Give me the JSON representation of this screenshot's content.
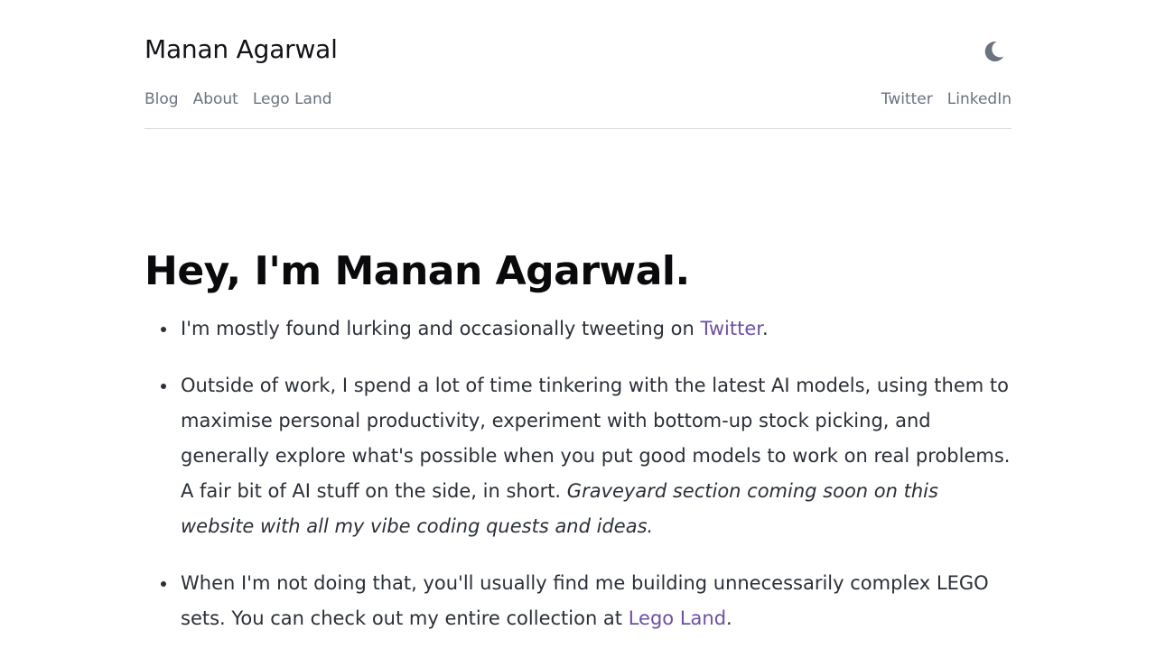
{
  "header": {
    "site_title": "Manan Agarwal",
    "theme_toggle_icon": "moon-icon",
    "nav_left": [
      {
        "label": "Blog"
      },
      {
        "label": "About"
      },
      {
        "label": "Lego Land"
      }
    ],
    "nav_right": [
      {
        "label": "Twitter"
      },
      {
        "label": "LinkedIn"
      }
    ]
  },
  "main": {
    "headline": "Hey, I'm Manan Agarwal.",
    "bullets": [
      {
        "text_before": "I'm mostly found lurking and occasionally tweeting on ",
        "link_text": "Twitter",
        "text_after": "."
      },
      {
        "text": "Outside of work, I spend a lot of time tinkering with the latest AI models, using them to maximise personal productivity, experiment with bottom-up stock picking, and generally explore what's possible when you put good models to work on real problems. A fair bit of AI stuff on the side, in short. ",
        "emphasis": "Graveyard section coming soon on this website with all my vibe coding quests and ideas."
      },
      {
        "text_before": "When I'm not doing that, you'll usually find me building unnecessarily complex LEGO sets. You can check out my entire collection at ",
        "link_text": "Lego Land",
        "text_after": "."
      }
    ]
  },
  "colors": {
    "link": "#6d4fa8",
    "nav_text": "#6b7280",
    "body_text": "#2b2f38",
    "heading": "#0a0a0c",
    "divider": "#d8dadd",
    "moon_icon": "#6b7280"
  }
}
